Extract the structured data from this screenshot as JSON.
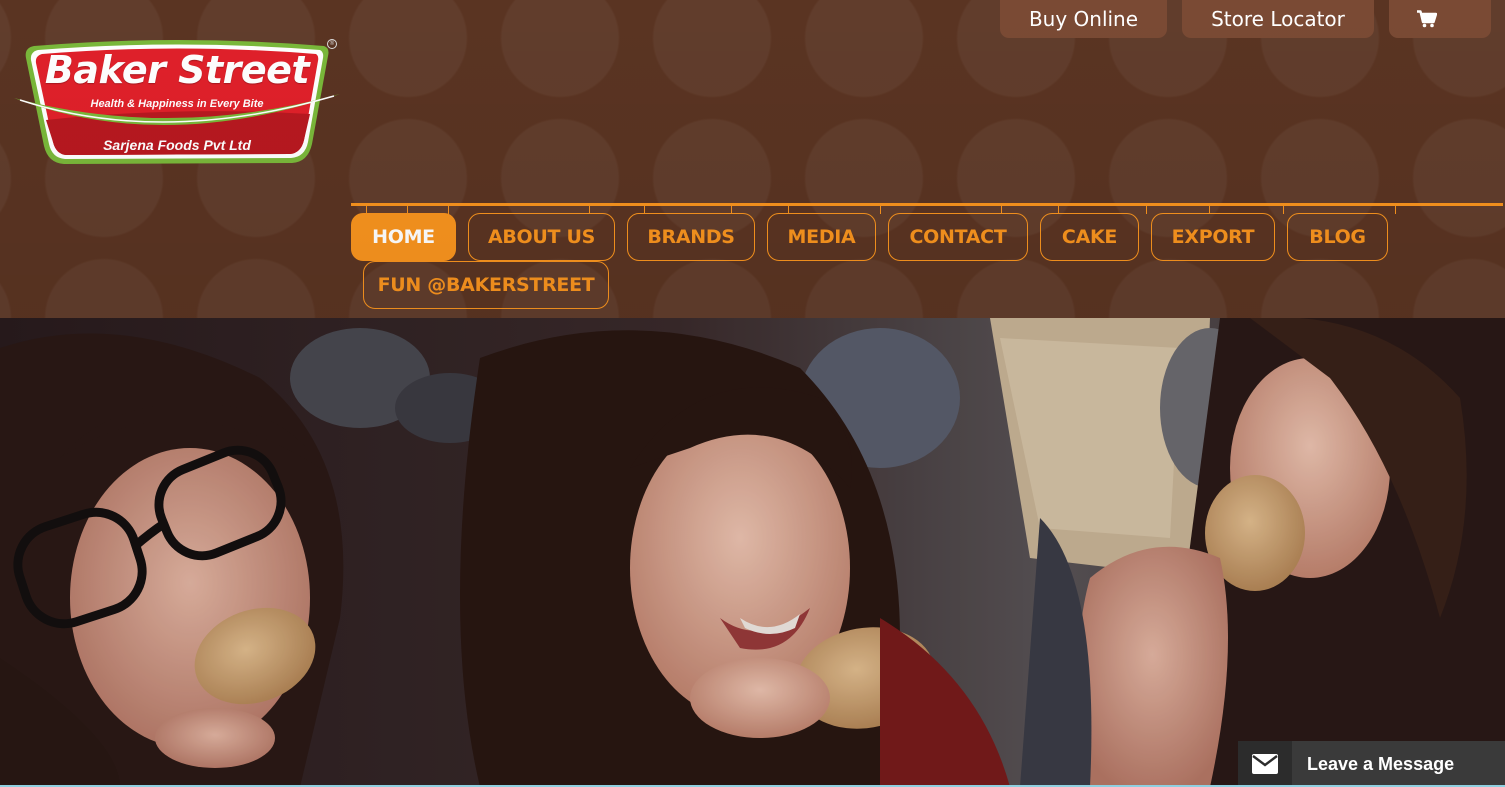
{
  "logo": {
    "brand": "Baker Street",
    "tagline": "Health & Happiness in Every Bite",
    "company": "Sarjena Foods Pvt Ltd",
    "registered_mark": "®"
  },
  "top_bar": {
    "buy_online": "Buy Online",
    "store_locator": "Store Locator",
    "cart_icon": "shopping-cart-icon"
  },
  "nav": {
    "items": [
      {
        "label": "HOME",
        "active": true
      },
      {
        "label": "ABOUT US",
        "active": false
      },
      {
        "label": "BRANDS",
        "active": false
      },
      {
        "label": "MEDIA",
        "active": false
      },
      {
        "label": "CONTACT",
        "active": false
      },
      {
        "label": "CAKE",
        "active": false
      },
      {
        "label": "EXPORT",
        "active": false
      },
      {
        "label": "BLOG",
        "active": false
      },
      {
        "label": "FUN @BAKERSTREET",
        "active": false
      }
    ]
  },
  "hero": {
    "image": "hero-banner-image"
  },
  "chat": {
    "label": "Leave a Message",
    "icon": "envelope-icon"
  },
  "colors": {
    "header_bg": "#5a3422",
    "accent_orange": "#f7931e",
    "top_button_bg": "#7a4a34",
    "logo_red": "#e0202a",
    "logo_green": "#7ab83a",
    "chat_bg": "#3a3a3a"
  }
}
